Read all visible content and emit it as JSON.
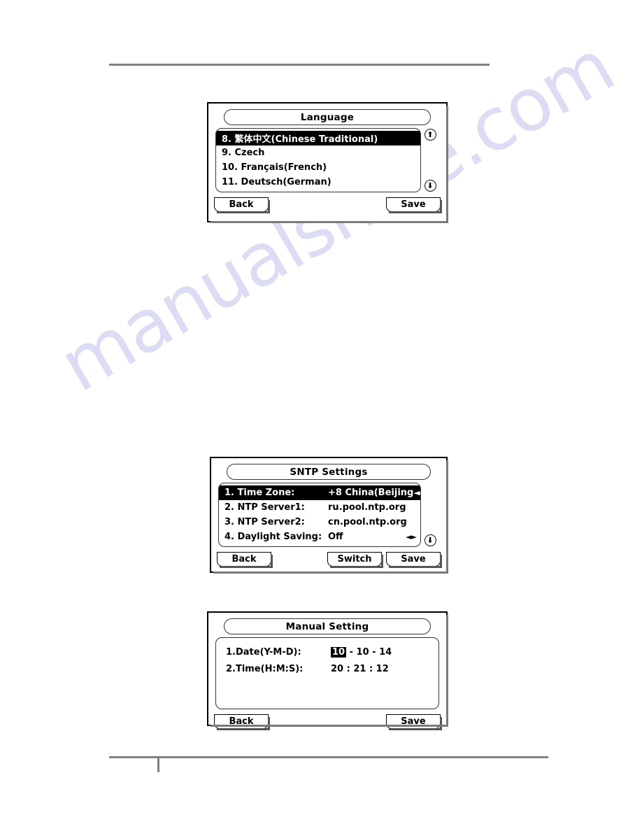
{
  "page": {
    "watermark": "manualshive.com",
    "watermark_color": "#dcdcf4",
    "rule_color": "#808080"
  },
  "screens": [
    {
      "id": "language",
      "title": "Language",
      "scroll_up_icon": "⬆",
      "scroll_down_icon": "⬇",
      "items": [
        {
          "text": "8. 繁体中文(Chinese Traditional)",
          "selected": true
        },
        {
          "text": "9. Czech",
          "selected": false
        },
        {
          "text": "10. Français(French)",
          "selected": false
        },
        {
          "text": "11. Deutsch(German)",
          "selected": false
        }
      ],
      "softkeys": {
        "back": "Back",
        "save": "Save"
      }
    },
    {
      "id": "sntp",
      "title": "SNTP Settings",
      "scroll_down_icon": "⬇",
      "rows": [
        {
          "key": "1. Time Zone:",
          "value": "+8 China(Beijing",
          "arrows": "◄►",
          "selected": true
        },
        {
          "key": "2. NTP Server1:",
          "value": "ru.pool.ntp.org",
          "arrows": "",
          "selected": false
        },
        {
          "key": "3. NTP Server2:",
          "value": "cn.pool.ntp.org",
          "arrows": "",
          "selected": false
        },
        {
          "key": "4. Daylight Saving:",
          "value": "Off",
          "arrows": "◄►",
          "selected": false
        }
      ],
      "softkeys": {
        "back": "Back",
        "switch": "Switch",
        "save": "Save"
      }
    },
    {
      "id": "manual",
      "title": "Manual Setting",
      "rows": [
        {
          "key": "1.Date(Y-M-D):",
          "highlight": "10",
          "rest": " - 10  - 14"
        },
        {
          "key": "2.Time(H:M:S):",
          "highlight": "",
          "rest": "20 : 21 : 12"
        }
      ],
      "softkeys": {
        "back": "Back",
        "save": "Save"
      }
    }
  ]
}
